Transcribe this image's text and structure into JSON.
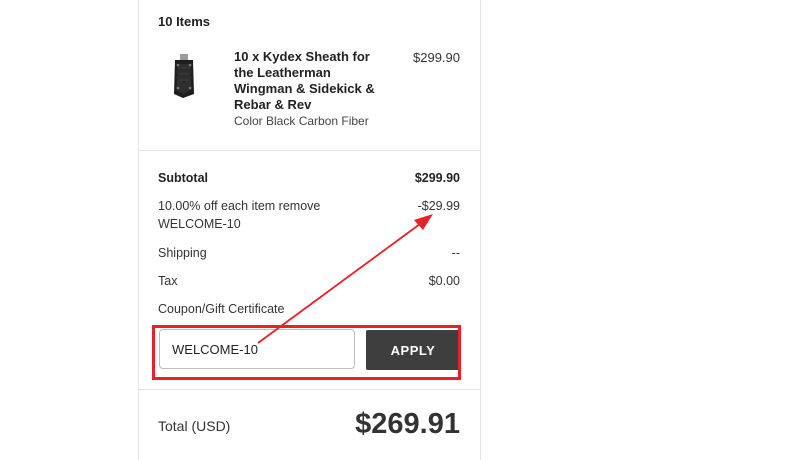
{
  "cart": {
    "items_title": "10 Items",
    "product": {
      "name": "10 x Kydex Sheath for the Leatherman Wingman & Sidekick & Rebar & Rev",
      "variant": "Color Black Carbon Fiber",
      "price": "$299.90",
      "image_icon": "kydex-sheath-image"
    }
  },
  "summary": {
    "subtotal_label": "Subtotal",
    "subtotal_value": "$299.90",
    "discount_label": "10.00% off each item remove WELCOME-10",
    "discount_value": "-$29.99",
    "shipping_label": "Shipping",
    "shipping_value": "--",
    "tax_label": "Tax",
    "tax_value": "$0.00",
    "coupon_label": "Coupon/Gift Certificate",
    "coupon_value": "WELCOME-10",
    "apply_label": "APPLY",
    "total_label": "Total (USD)",
    "total_value": "$269.91"
  },
  "annotation": {
    "color": "#e8202a"
  }
}
